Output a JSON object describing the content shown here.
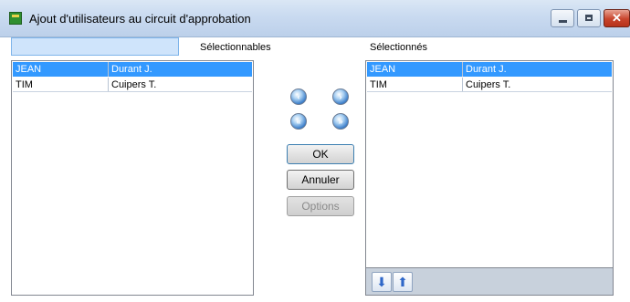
{
  "window": {
    "title": "Ajout d'utilisateurs au circuit d'approbation",
    "close_glyph": "✕"
  },
  "search": {
    "value": ""
  },
  "left_panel": {
    "label": "Sélectionnables",
    "rows": [
      {
        "code": "JEAN",
        "name": "Durant J.",
        "selected": true
      },
      {
        "code": "TIM",
        "name": "Cuipers T.",
        "selected": false
      }
    ]
  },
  "right_panel": {
    "label": "Sélectionnés",
    "rows": [
      {
        "code": "JEAN",
        "name": "Durant J.",
        "selected": true
      },
      {
        "code": "TIM",
        "name": "Cuipers T.",
        "selected": false
      }
    ]
  },
  "transfer_buttons": {
    "add_one": "‹",
    "remove_one": "›",
    "add_all": "«",
    "remove_all": "»"
  },
  "buttons": {
    "ok": "OK",
    "cancel": "Annuler",
    "options": "Options"
  },
  "order_buttons": {
    "down": "⬇",
    "up": "⬆"
  },
  "colors": {
    "selection": "#3399ff",
    "search_bg": "#cfe4fb",
    "close_red": "#c8442c"
  }
}
